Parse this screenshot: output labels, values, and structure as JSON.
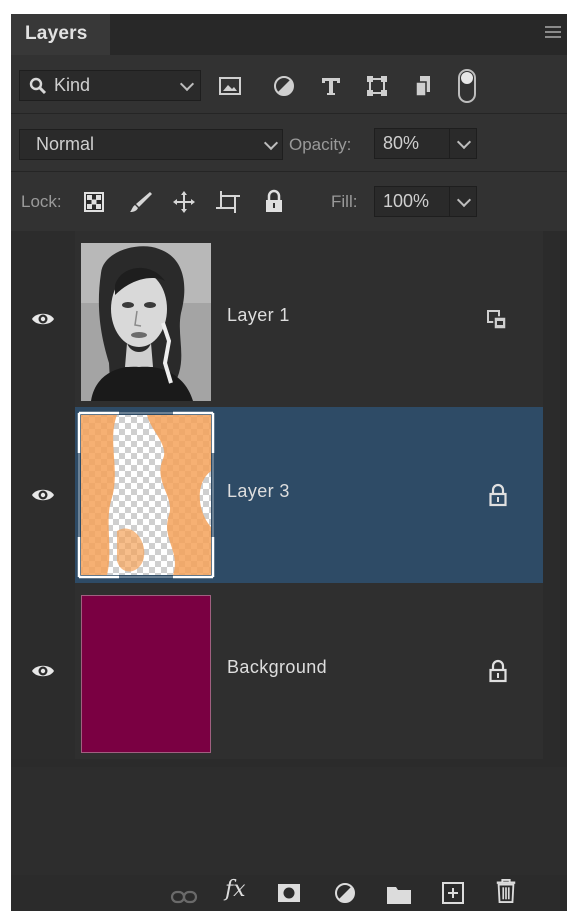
{
  "panel": {
    "tab_label": "Layers"
  },
  "filter": {
    "kind_label": "Kind",
    "icons": [
      "image-filter-icon",
      "adjustment-filter-icon",
      "type-filter-icon",
      "shape-filter-icon",
      "smart-object-filter-icon",
      "filter-toggle-switch"
    ]
  },
  "blend": {
    "mode": "Normal",
    "opacity_label": "Opacity:",
    "opacity_value": "80%"
  },
  "lock": {
    "label": "Lock:",
    "icons": [
      "lock-transparent-pixels-icon",
      "lock-image-pixels-icon",
      "lock-position-icon",
      "lock-artboard-icon",
      "lock-all-icon"
    ],
    "fill_label": "Fill:",
    "fill_value": "100%"
  },
  "layers": [
    {
      "name": "Layer 1",
      "selected": false,
      "visible": true,
      "badge": "linked-smart-object-icon",
      "thumbnail": "portrait-photo-grayscale"
    },
    {
      "name": "Layer 3",
      "selected": true,
      "visible": true,
      "badge": "lock-icon",
      "thumbnail": "orange-transparency-pattern"
    },
    {
      "name": "Background",
      "selected": false,
      "visible": true,
      "badge": "lock-icon",
      "thumbnail": "solid-color",
      "color": "#7a0042"
    }
  ],
  "footer_icons": [
    "link-layers-icon",
    "fx-icon",
    "add-mask-icon",
    "adjustment-layer-icon",
    "new-group-icon",
    "new-layer-icon",
    "delete-layer-icon"
  ],
  "colors": {
    "panel_bg": "#323232",
    "selected_row": "#2e4b66",
    "background_swatch": "#7a0042",
    "accent_orange": "#f4a25a"
  }
}
